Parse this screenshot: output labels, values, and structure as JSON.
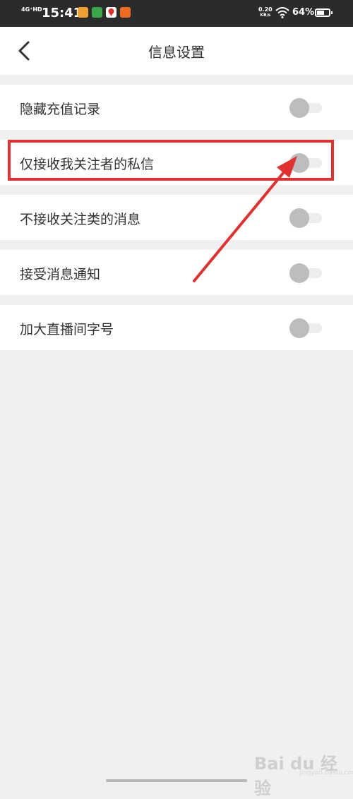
{
  "statusbar": {
    "network": "4G⁺HD",
    "time": "15:41",
    "net_speed_value": "0.20",
    "net_speed_unit": "KB/s",
    "battery_text": "64%",
    "battery_level": 0.64,
    "app_icons": [
      "orange-app-icon",
      "green-app-icon",
      "map-pin-app-icon",
      "orange-app-icon-2"
    ],
    "background_color": "#2b2b2b"
  },
  "navbar": {
    "title": "信息设置",
    "back_icon": "chevron-left-icon"
  },
  "settings": [
    {
      "label": "隐藏充值记录",
      "enabled": false
    },
    {
      "label": "仅接收我关注者的私信",
      "enabled": false
    },
    {
      "label": "不接收关注类的消息",
      "enabled": false
    },
    {
      "label": "接受消息通知",
      "enabled": false
    },
    {
      "label": "加大直播间字号",
      "enabled": false
    }
  ],
  "annotation": {
    "highlight_color": "#e03030",
    "target": "仅接收我关注者的私信"
  },
  "watermark": {
    "text": "Bai du 经验",
    "sub": "jingyan.baidu.com"
  }
}
